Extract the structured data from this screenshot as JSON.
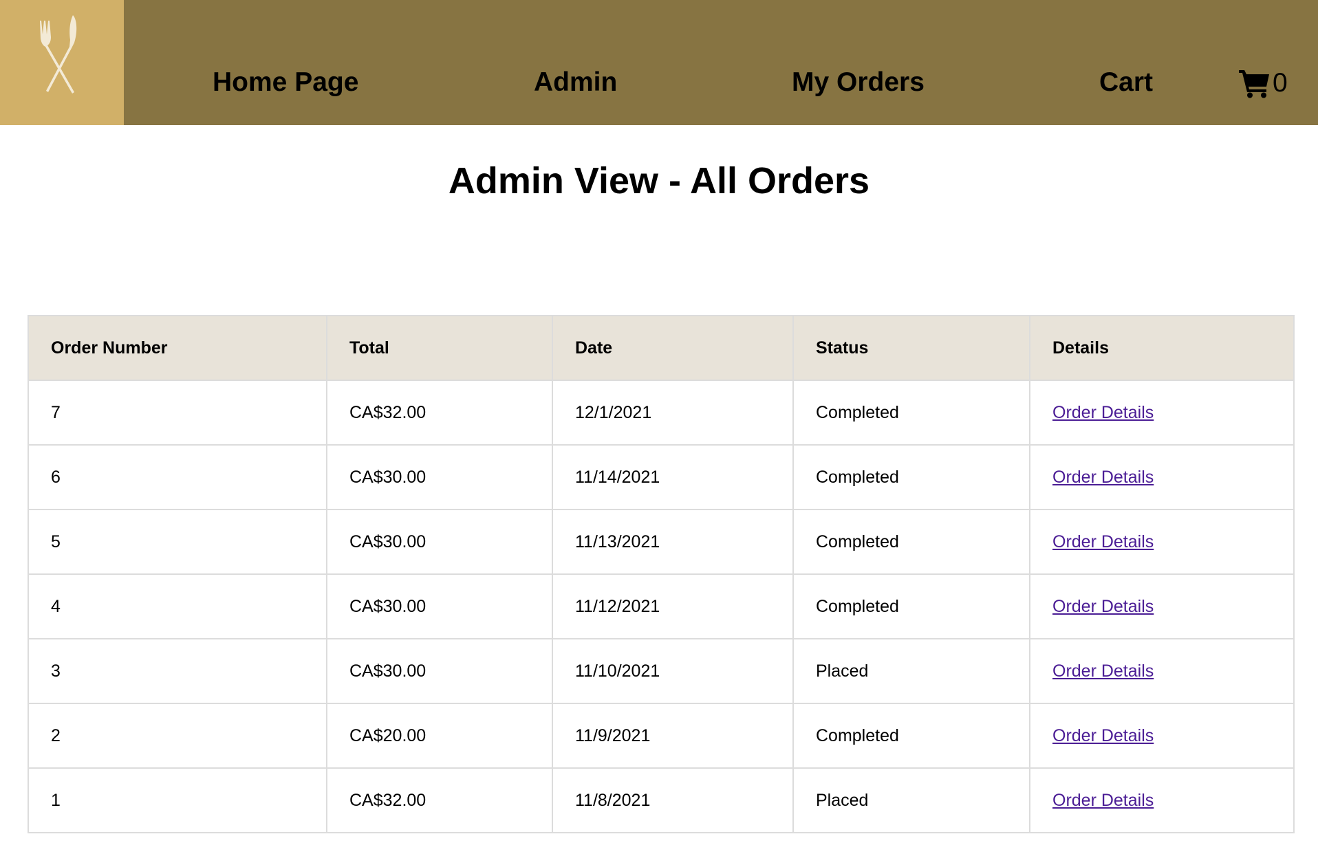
{
  "nav": {
    "home": "Home Page",
    "admin": "Admin",
    "my_orders": "My Orders",
    "cart": "Cart",
    "cart_count": "0",
    "logo_icon": "fork-knife-icon",
    "cart_icon": "shopping-cart-icon"
  },
  "colors": {
    "navbar": "#877442",
    "logo_bg": "#d1b068",
    "table_header_bg": "#e8e3d9",
    "link": "#4b1d95"
  },
  "page": {
    "title": "Admin View - All Orders"
  },
  "table": {
    "headers": {
      "order_number": "Order Number",
      "total": "Total",
      "date": "Date",
      "status": "Status",
      "details": "Details"
    },
    "rows": [
      {
        "number": "7",
        "total": "CA$32.00",
        "date": "12/1/2021",
        "status": "Completed",
        "details": "Order Details"
      },
      {
        "number": "6",
        "total": "CA$30.00",
        "date": "11/14/2021",
        "status": "Completed",
        "details": "Order Details"
      },
      {
        "number": "5",
        "total": "CA$30.00",
        "date": "11/13/2021",
        "status": "Completed",
        "details": "Order Details"
      },
      {
        "number": "4",
        "total": "CA$30.00",
        "date": "11/12/2021",
        "status": "Completed",
        "details": "Order Details"
      },
      {
        "number": "3",
        "total": "CA$30.00",
        "date": "11/10/2021",
        "status": "Placed",
        "details": "Order Details"
      },
      {
        "number": "2",
        "total": "CA$20.00",
        "date": "11/9/2021",
        "status": "Completed",
        "details": "Order Details"
      },
      {
        "number": "1",
        "total": "CA$32.00",
        "date": "11/8/2021",
        "status": "Placed",
        "details": "Order Details"
      }
    ]
  }
}
